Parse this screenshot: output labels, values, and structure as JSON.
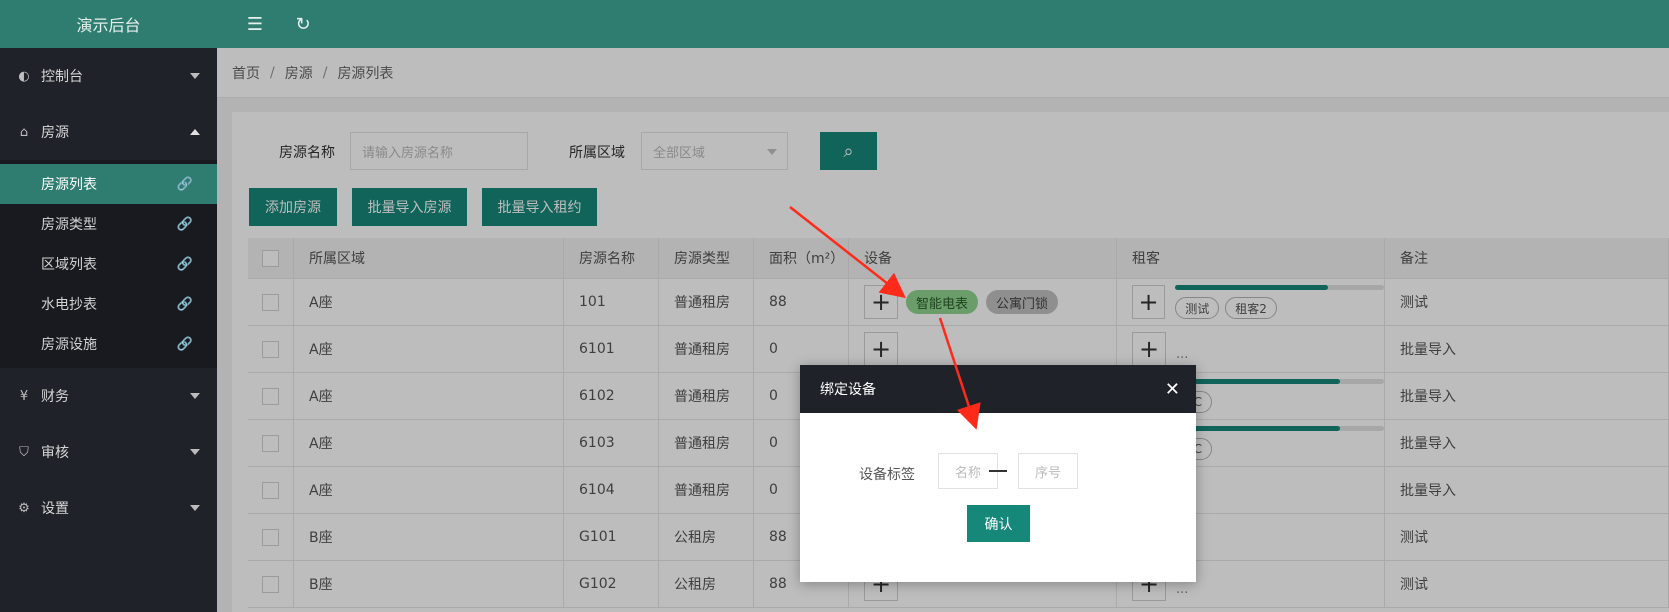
{
  "app": {
    "title": "演示后台"
  },
  "sidebar": {
    "groups": [
      {
        "label": "控制台",
        "icon": "dashboard-icon"
      },
      {
        "label": "房源",
        "icon": "home-icon"
      },
      {
        "label": "财务",
        "icon": "yen-icon"
      },
      {
        "label": "审核",
        "icon": "shield-check-icon"
      },
      {
        "label": "设置",
        "icon": "gear-icon"
      }
    ],
    "subitems": [
      "房源列表",
      "房源类型",
      "区域列表",
      "水电抄表",
      "房源设施"
    ]
  },
  "breadcrumb": [
    "首页",
    "房源",
    "房源列表"
  ],
  "search": {
    "name_label": "房源名称",
    "name_placeholder": "请输入房源名称",
    "area_label": "所属区域",
    "area_value": "全部区域"
  },
  "actions": {
    "add": "添加房源",
    "import_houses": "批量导入房源",
    "import_leases": "批量导入租约"
  },
  "table": {
    "headers": [
      "所属区域",
      "房源名称",
      "房源类型",
      "面积（m²）",
      "设备",
      "租客",
      "备注"
    ],
    "rows": [
      {
        "area": "A座",
        "name": "101",
        "type": "普通租房",
        "size": "88",
        "devices": [
          "智能电表",
          "公寓门锁"
        ],
        "tenants": [
          "测试",
          "租客2"
        ],
        "progress": 0.73,
        "note": "测试"
      },
      {
        "area": "A座",
        "name": "6101",
        "type": "普通租房",
        "size": "0",
        "devices": [],
        "tenants": [],
        "note": "批量导入"
      },
      {
        "area": "A座",
        "name": "6102",
        "type": "普通租房",
        "size": "0",
        "devices": [],
        "tenants": [
          "CC"
        ],
        "progress": 0.79,
        "note": "批量导入"
      },
      {
        "area": "A座",
        "name": "6103",
        "type": "普通租房",
        "size": "0",
        "devices": [],
        "tenants": [
          "CC"
        ],
        "progress": 0.79,
        "note": "批量导入"
      },
      {
        "area": "A座",
        "name": "6104",
        "type": "普通租房",
        "size": "0",
        "devices": [],
        "tenants": [],
        "note": "批量导入"
      },
      {
        "area": "B座",
        "name": "G101",
        "type": "公租房",
        "size": "88",
        "devices": [],
        "tenants": [],
        "note": "测试"
      },
      {
        "area": "B座",
        "name": "G102",
        "type": "公租房",
        "size": "88",
        "devices": [],
        "tenants": [],
        "note": "测试"
      }
    ],
    "empty_marker": "..."
  },
  "modal": {
    "title": "绑定设备",
    "field_label": "设备标签",
    "name_placeholder": "名称",
    "number_placeholder": "序号",
    "confirm": "确认"
  },
  "colors": {
    "primary": "#16887a",
    "header": "#2f7d70",
    "sidebar": "#20222a",
    "arrow": "#ff2a1a"
  }
}
